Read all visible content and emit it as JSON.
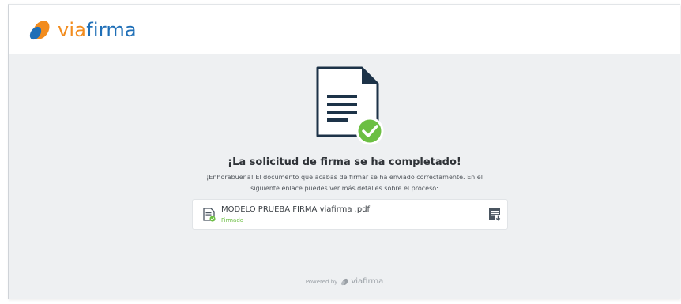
{
  "header": {
    "logo_via": "via",
    "logo_firma": "firma"
  },
  "illustration": {
    "icon": "document-check-icon"
  },
  "main": {
    "title": "¡La solicitud de firma se ha completado!",
    "message": "¡Enhorabuena! El documento que acabas de firmar se ha enviado correctamente. En el siguiente enlace puedes ver más detalles sobre el proceso:"
  },
  "document": {
    "file_name": "MODELO PRUEBA FIRMA viafirma .pdf",
    "status": "Firmado",
    "file_icon": "signed-file-icon",
    "action_icon": "download-document-icon"
  },
  "footer": {
    "powered_by": "Powered by",
    "brand_via": "via",
    "brand_firma": "firma"
  },
  "colors": {
    "brand_orange": "#f28c1e",
    "brand_blue": "#1f6fb7",
    "success_green": "#6cbf43",
    "page_bg": "#eef0f2",
    "doc_dark": "#1d3348"
  }
}
